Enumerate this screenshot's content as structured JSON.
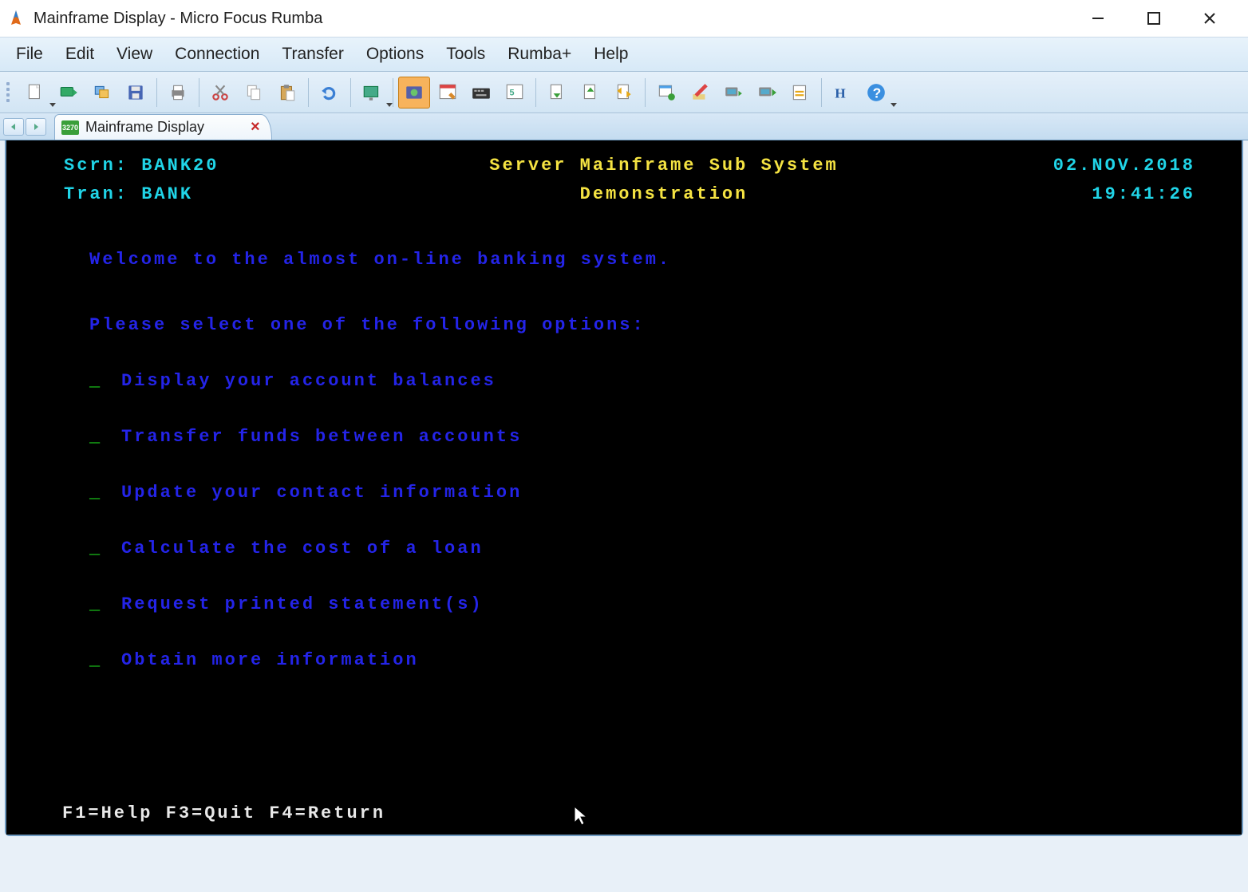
{
  "window": {
    "title": "Mainframe Display - Micro Focus Rumba"
  },
  "menu": {
    "items": [
      "File",
      "Edit",
      "View",
      "Connection",
      "Transfer",
      "Options",
      "Tools",
      "Rumba+",
      "Help"
    ]
  },
  "toolbar": {
    "buttons": [
      "new-document",
      "connect",
      "disconnect",
      "save",
      "print",
      "cut",
      "copy",
      "paste",
      "undo",
      "screen-settings",
      "|",
      "record-macro",
      "screen-designer",
      "keyboard-map",
      "script-editor",
      "|",
      "upload",
      "download",
      "transfer-settings",
      "|",
      "launch-app",
      "edit-script",
      "associate",
      "run-script",
      "screen-capture",
      "|",
      "history",
      "help"
    ],
    "active_index": 11
  },
  "tabs": {
    "label": "Mainframe Display",
    "icon_text": "3270"
  },
  "term": {
    "scrn_label": "Scrn:",
    "scrn_value": "BANK20",
    "tran_label": "Tran:",
    "tran_value": "BANK",
    "title1": "Server Mainframe Sub System",
    "title2": "Demonstration",
    "date": "02.NOV.2018",
    "time": "19:41:26",
    "welcome": "Welcome to the almost on-line banking system.",
    "prompt": "Please select one of the following options:",
    "options": [
      "Display your account balances",
      "Transfer funds between accounts",
      "Update your contact information",
      "Calculate the cost of a loan",
      "Request printed statement(s)",
      "Obtain more information"
    ],
    "fkeys": "F1=Help F3=Quit F4=Return"
  }
}
